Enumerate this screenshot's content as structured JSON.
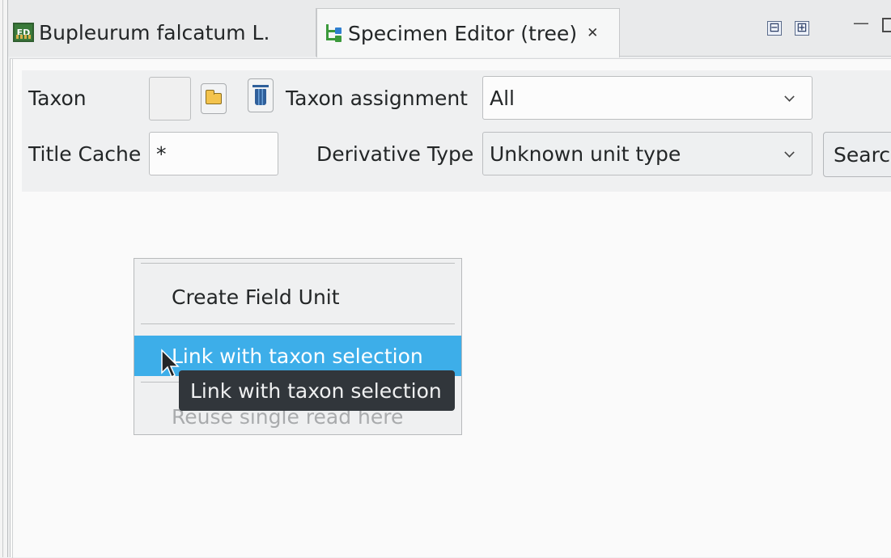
{
  "tabs": [
    {
      "label": "Bupleurum falcatum L.",
      "icon": "ed-icon",
      "active": false
    },
    {
      "label": "Specimen Editor (tree)",
      "icon": "tree-icon",
      "active": true,
      "close_glyph": "✕"
    }
  ],
  "window_controls": {
    "collapse_all": "⊟",
    "expand_all": "⊞",
    "minimize": "—"
  },
  "form": {
    "taxon_label": "Taxon",
    "taxon_value": "",
    "taxon_assignment_label": "Taxon assignment",
    "taxon_assignment_value": "All",
    "title_cache_label": "Title Cache",
    "title_cache_value": "*",
    "derivative_type_label": "Derivative Type",
    "derivative_type_value": "Unknown unit type",
    "search_label": "Search"
  },
  "context_menu": {
    "items": [
      {
        "label": "Create Field Unit",
        "state": "normal"
      },
      {
        "label": "Link with taxon selection",
        "state": "highlighted"
      },
      {
        "label": "Reuse single read here",
        "state": "disabled"
      }
    ]
  },
  "tooltip": {
    "text": "Link with taxon selection"
  },
  "colors": {
    "highlight": "#3daee9",
    "tooltip_bg": "#31363b",
    "window_bg": "#eff0f1"
  }
}
